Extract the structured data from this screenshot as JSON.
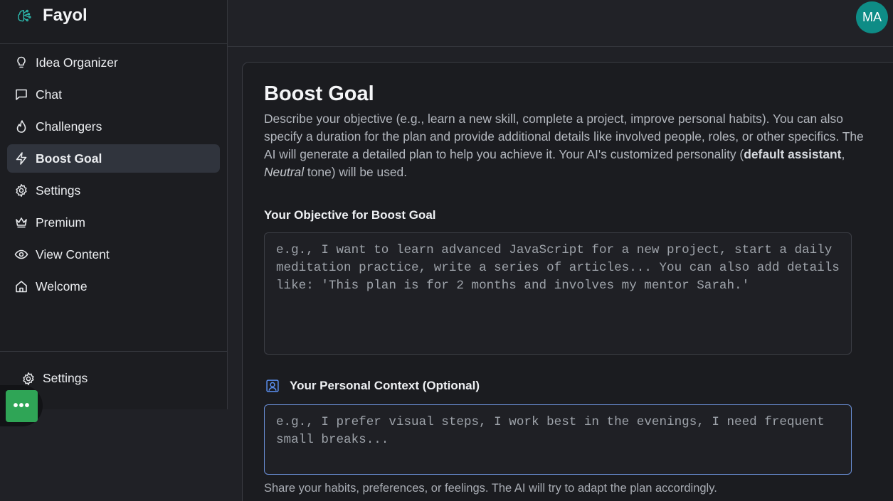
{
  "brand": {
    "name": "Fayol",
    "accent": "#2cb3a8"
  },
  "sidebar": {
    "items": [
      {
        "label": "Idea Organizer",
        "icon": "lightbulb-icon",
        "active": false
      },
      {
        "label": "Chat",
        "icon": "chat-bubble-icon",
        "active": false
      },
      {
        "label": "Challengers",
        "icon": "flame-icon",
        "active": false
      },
      {
        "label": "Boost Goal",
        "icon": "lightning-icon",
        "active": true
      },
      {
        "label": "Settings",
        "icon": "gear-icon",
        "active": false
      },
      {
        "label": "Premium",
        "icon": "crown-icon",
        "active": false
      },
      {
        "label": "View Content",
        "icon": "eye-icon",
        "active": false
      },
      {
        "label": "Welcome",
        "icon": "home-icon",
        "active": false
      }
    ],
    "bottom_settings_label": "Settings",
    "fab_label": "•••"
  },
  "header": {
    "avatar_initials": "MA",
    "avatar_color": "#0e8c86"
  },
  "main": {
    "title": "Boost Goal",
    "description_part1": "Describe your objective (e.g., learn a new skill, complete a project, improve personal habits). You can also specify a duration for the plan and provide additional details like involved people, roles, or other specifics. The AI will generate a detailed plan to help you achieve it. Your AI's customized personality (",
    "description_bold": "default assistant",
    "description_part2": ", ",
    "description_italic": "Neutral",
    "description_part3": " tone) will be used.",
    "objective_label": "Your Objective for Boost Goal",
    "objective_placeholder": "e.g., I want to learn advanced JavaScript for a new project, start a daily meditation practice, write a series of articles... You can also add details like: 'This plan is for 2 months and involves my mentor Sarah.'",
    "context_label": "Your Personal Context (Optional)",
    "context_icon": "user-portrait-icon",
    "context_placeholder": "e.g., I prefer visual steps, I work best in the evenings, I need frequent small breaks...",
    "context_helper": "Share your habits, preferences, or feelings. The AI will try to adapt the plan accordingly."
  }
}
